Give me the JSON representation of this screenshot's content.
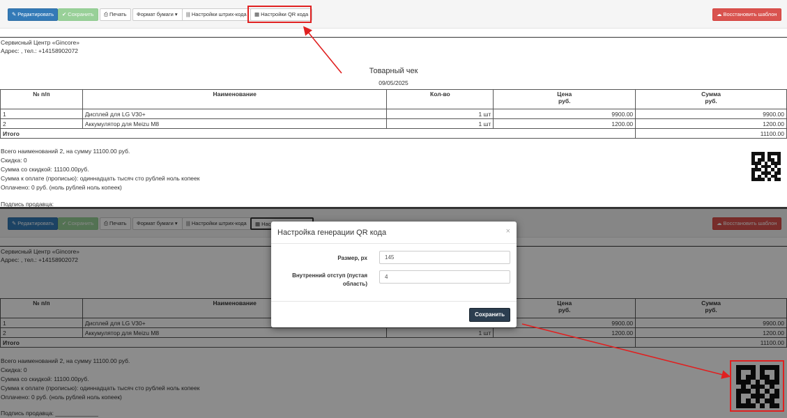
{
  "toolbar": {
    "edit_label": "Редактировать",
    "save_label": "Сохранить",
    "print_label": "Печать",
    "paper_format_label": "Формат бумаги",
    "barcode_settings_label": "Настройки штрих-кода",
    "qr_settings_label": "Настройки QR кода",
    "restore_template_label": "Восстановить шаблон"
  },
  "receipt": {
    "company": "Сервисный Центр «Gincore»",
    "address": "Адрес: , тел.: +14158902072",
    "title": "Товарный чек",
    "date": "09/05/2025",
    "columns": [
      "№ п/п",
      "Наименование",
      "Кол-во",
      "Цена",
      "Сумма"
    ],
    "currency": "руб.",
    "rows": [
      {
        "n": "1",
        "name": "Дисплей для LG V30+",
        "qty": "1 шт",
        "price": "9900.00",
        "sum": "9900.00"
      },
      {
        "n": "2",
        "name": "Аккумулятор для Meizu M8",
        "qty": "1 шт",
        "price": "1200.00",
        "sum": "1200.00"
      }
    ],
    "total_label": "Итого",
    "total_value": "11100.00",
    "summary": [
      "Всего наименований 2, на сумму 11100.00 руб.",
      "Скидка: 0",
      "Сумма со скидкой: 11100.00руб.",
      "Сумма к оплате (прописью): одиннадцать тысяч сто рублей ноль копеек",
      "Оплачено: 0 руб. (ноль рублей ноль копеек)"
    ],
    "signature": "Подпись продавца: _____________"
  },
  "modal": {
    "title": "Настройка генерации QR кода",
    "close": "×",
    "size_label": "Размер, px",
    "size_value": "145",
    "padding_label": "Внутренний отступ (пустая область)",
    "padding_value": "4",
    "save_label": "Сохранить"
  },
  "colors": {
    "annotation": "#e02020",
    "primary": "#337ab7",
    "success": "#5cb85c",
    "danger": "#d9534f",
    "modal_button": "#2c3e50"
  }
}
